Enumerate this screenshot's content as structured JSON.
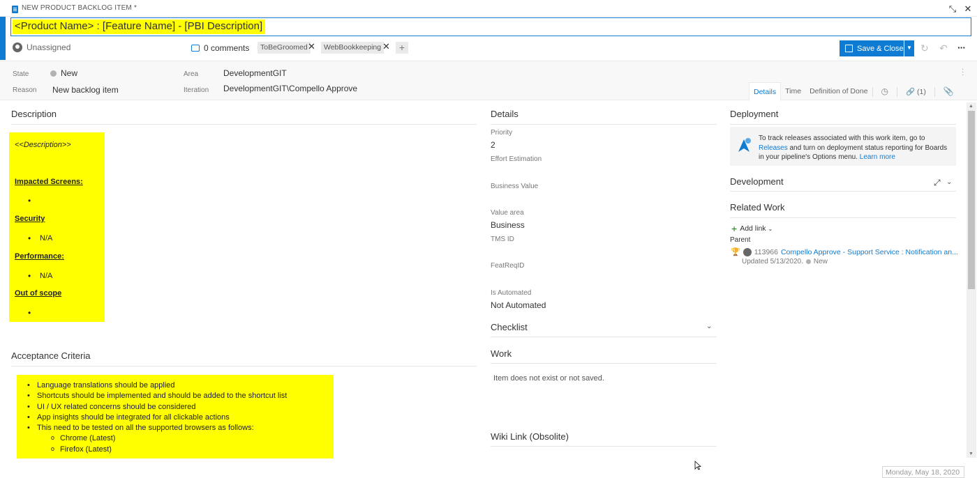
{
  "window": {
    "title": "NEW PRODUCT BACKLOG ITEM *",
    "collapse_icon": "collapse-icon",
    "close_icon": "close-icon"
  },
  "work_item": {
    "title": "<Product Name> : [Feature Name] - [PBI Description]",
    "assignee": "Unassigned",
    "comments": "0 comments",
    "tags": [
      "ToBeGroomed",
      "WebBookkeeping"
    ],
    "save_label": "Save & Close"
  },
  "fields": {
    "state_label": "State",
    "state_value": "New",
    "reason_label": "Reason",
    "reason_value": "New backlog item",
    "area_label": "Area",
    "area_value": "DevelopmentGIT",
    "iteration_label": "Iteration",
    "iteration_value": "DevelopmentGIT\\Compello Approve"
  },
  "tabs": {
    "details": "Details",
    "time": "Time",
    "dod": "Definition of Done",
    "links": "(1)"
  },
  "description": {
    "heading": "Description",
    "placeholder": "<<Description>>",
    "impacted_heading": "Impacted Screens:",
    "security_heading": "Security",
    "security_value": "N/A",
    "performance_heading": "Performance:",
    "performance_value": "N/A",
    "scope_heading": "Out of scope"
  },
  "acceptance": {
    "heading": "Acceptance Criteria",
    "items": [
      "Language translations should be applied",
      "Shortcuts should be implemented and should be added to the shortcut list",
      "UI / UX related concerns should be considered",
      "App insights should be integrated for all clickable actions",
      "This need to be tested on all the supported browsers as follows:"
    ],
    "sub_items": [
      "Chrome (Latest)",
      "Firefox (Latest)"
    ]
  },
  "details": {
    "heading": "Details",
    "priority_label": "Priority",
    "priority_value": "2",
    "effort_label": "Effort Estimation",
    "business_value_label": "Business Value",
    "value_area_label": "Value area",
    "value_area_value": "Business",
    "tms_label": "TMS ID",
    "featreq_label": "FeatReqID",
    "automated_label": "Is Automated",
    "automated_value": "Not Automated",
    "checklist_heading": "Checklist",
    "work_heading": "Work",
    "work_text": "Item does not exist or not saved.",
    "wiki_heading": "Wiki Link (Obsolite)"
  },
  "deployment": {
    "heading": "Deployment",
    "text_before": "To track releases associated with this work item, go to ",
    "releases_link": "Releases",
    "text_middle": " and turn on deployment status reporting for Boards in your pipeline's Options menu. ",
    "learn_more": "Learn more"
  },
  "development": {
    "heading": "Development"
  },
  "related_work": {
    "heading": "Related Work",
    "add_link": "Add link",
    "parent_label": "Parent",
    "parent_id": "113966",
    "parent_title": "Compello Approve - Support Service : Notification an...",
    "parent_updated": "Updated 5/13/2020.",
    "parent_state": "New"
  },
  "status": {
    "date": "Monday, May 18, 2020"
  },
  "colors": {
    "accent": "#0f7bd2",
    "highlight": "#ffff00",
    "state_new": "#b2b2b2"
  }
}
